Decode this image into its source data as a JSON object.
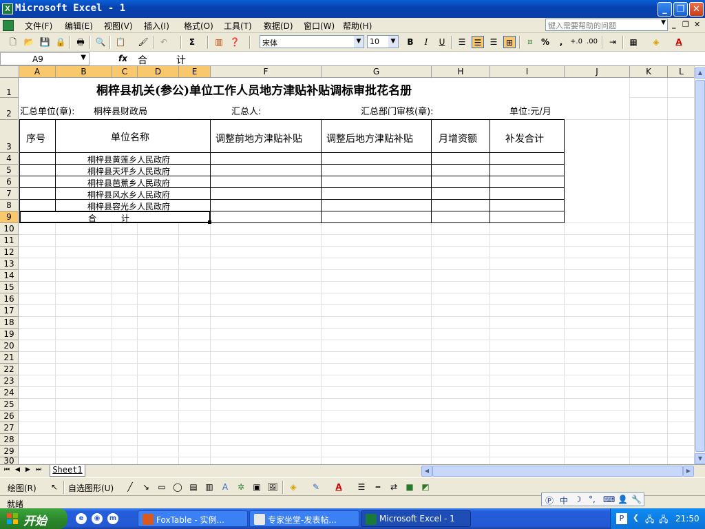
{
  "window": {
    "title": "Microsoft Excel - 1",
    "app_icon": "excel-icon"
  },
  "menu": {
    "items": [
      "文件(F)",
      "编辑(E)",
      "视图(V)",
      "插入(I)",
      "格式(O)",
      "工具(T)",
      "数据(D)",
      "窗口(W)",
      "帮助(H)"
    ],
    "help_placeholder": "键入需要帮助的问题"
  },
  "toolbar": {
    "font_name": "宋体",
    "font_size": "10",
    "bold": "B",
    "italic": "I",
    "underline": "U",
    "percent": "%",
    "comma": ",",
    "sum": "Σ",
    "font_color": "A",
    "accent_color": "#316ac5",
    "active_color": "#fcc86c"
  },
  "formula_bar": {
    "name_box": "A9",
    "fx": "fx",
    "formula": "合　　　计"
  },
  "columns": [
    "A",
    "B",
    "C",
    "D",
    "E",
    "F",
    "G",
    "H",
    "I",
    "J",
    "K",
    "L"
  ],
  "rows": [
    "1",
    "2",
    "3",
    "4",
    "5",
    "6",
    "7",
    "8",
    "9",
    "10",
    "11",
    "12",
    "13",
    "14",
    "15",
    "16",
    "17",
    "18",
    "19",
    "20",
    "21",
    "22",
    "23",
    "24",
    "25",
    "26",
    "27",
    "28",
    "29",
    "30"
  ],
  "sheet": {
    "title": "桐梓县机关(参公)单位工作人员地方津贴补贴调标审批花名册",
    "summary_unit_label": "汇总单位(章):",
    "summary_unit_value": "桐梓县财政局",
    "summarizer_label": "汇总人:",
    "dept_review_label": "汇总部门审核(章):",
    "unit_label": "单位:元/月",
    "headers": {
      "seq": "序号",
      "unit_name": "单位名称",
      "before": "调整前地方津贴补贴",
      "after": "调整后地方津贴补贴",
      "monthly_increase": "月增资额",
      "back_pay_total": "补发合计"
    },
    "units": [
      "桐梓县黄莲乡人民政府",
      "桐梓县天坪乡人民政府",
      "桐梓县芭蕉乡人民政府",
      "桐梓县风水乡人民政府",
      "桐梓县容光乡人民政府"
    ],
    "total_label": "合　　　计"
  },
  "sheet_tab": "Sheet1",
  "drawing_toolbar": {
    "draw": "绘图(R)",
    "autoshapes": "自选图形(U)"
  },
  "status": {
    "text": "就绪"
  },
  "taskbar": {
    "start": "开始",
    "tasks": [
      "FoxTable - 实例...",
      "专家坐堂-发表帖...",
      "Microsoft Excel - 1"
    ],
    "clock": "21:50"
  },
  "ime": {
    "mode": "中"
  }
}
